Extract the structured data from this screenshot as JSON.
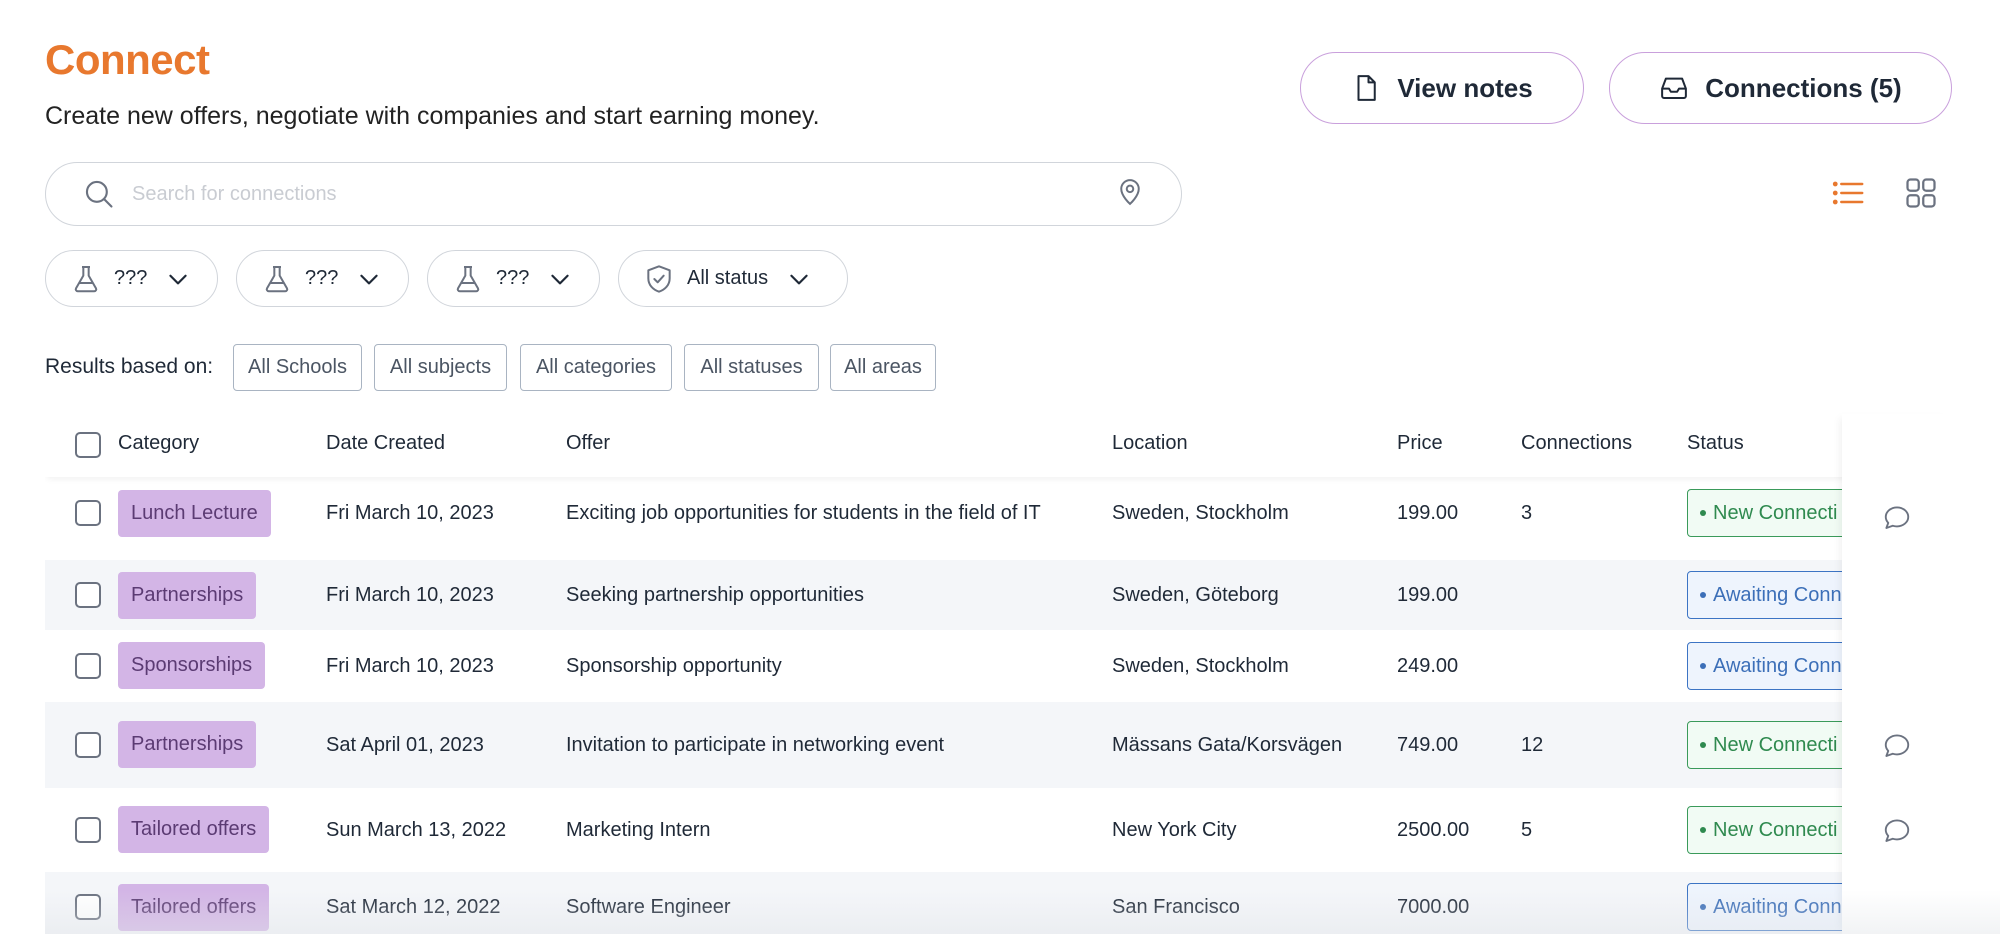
{
  "header": {
    "title": "Connect",
    "subtitle": "Create new offers, negotiate with companies and start earning money.",
    "view_notes_label": "View notes",
    "connections_label": "Connections (5)"
  },
  "search": {
    "placeholder": "Search for connections",
    "value": ""
  },
  "view_toggle": {
    "active": "list",
    "accent_color": "#e8782e"
  },
  "filters": [
    {
      "label": "???",
      "icon": "flask-icon"
    },
    {
      "label": "???",
      "icon": "flask-icon"
    },
    {
      "label": "???",
      "icon": "flask-icon"
    },
    {
      "label": "All status",
      "icon": "shield-check-icon"
    }
  ],
  "results": {
    "label": "Results based on:",
    "chips": [
      "All Schools",
      "All subjects",
      "All categories",
      "All statuses",
      "All areas"
    ]
  },
  "table": {
    "columns": [
      "Category",
      "Date Created",
      "Offer",
      "Location",
      "Price",
      "Connections",
      "Status"
    ],
    "rows": [
      {
        "category": "Lunch Lecture",
        "date": "Fri March 10, 2023",
        "offer": "Exciting job opportunities for students in the field of IT",
        "location": "Sweden, Stockholm",
        "price": "199.00",
        "connections": "3",
        "status": "New Connecti",
        "status_type": "new",
        "has_chat": true
      },
      {
        "category": "Partnerships",
        "date": "Fri March 10, 2023",
        "offer": "Seeking partnership opportunities",
        "location": "Sweden, Göteborg",
        "price": "199.00",
        "connections": "",
        "status": "Awaiting Conn",
        "status_type": "await",
        "has_chat": false
      },
      {
        "category": "Sponsorships",
        "date": "Fri March 10, 2023",
        "offer": "Sponsorship opportunity",
        "location": "Sweden, Stockholm",
        "price": "249.00",
        "connections": "",
        "status": "Awaiting Conn",
        "status_type": "await",
        "has_chat": false
      },
      {
        "category": "Partnerships",
        "date": "Sat April 01, 2023",
        "offer": "Invitation to participate in networking event",
        "location": "Mässans Gata/Korsvägen",
        "price": "749.00",
        "connections": "12",
        "status": "New Connecti",
        "status_type": "new",
        "has_chat": true
      },
      {
        "category": "Tailored offers",
        "date": "Sun March 13, 2022",
        "offer": "Marketing Intern",
        "location": "New York City",
        "price": "2500.00",
        "connections": "5",
        "status": "New Connecti",
        "status_type": "new",
        "has_chat": true
      },
      {
        "category": "Tailored offers",
        "date": "Sat March 12, 2022",
        "offer": "Software Engineer",
        "location": "San Francisco",
        "price": "7000.00",
        "connections": "",
        "status": "Awaiting Conn",
        "status_type": "await",
        "has_chat": false
      }
    ]
  },
  "colors": {
    "title": "#e8782e",
    "category_badge_bg": "#d3b5e6",
    "status_new": "#2f8a4f",
    "status_await": "#3c6fb8",
    "button_border": "#c9a0dc"
  }
}
